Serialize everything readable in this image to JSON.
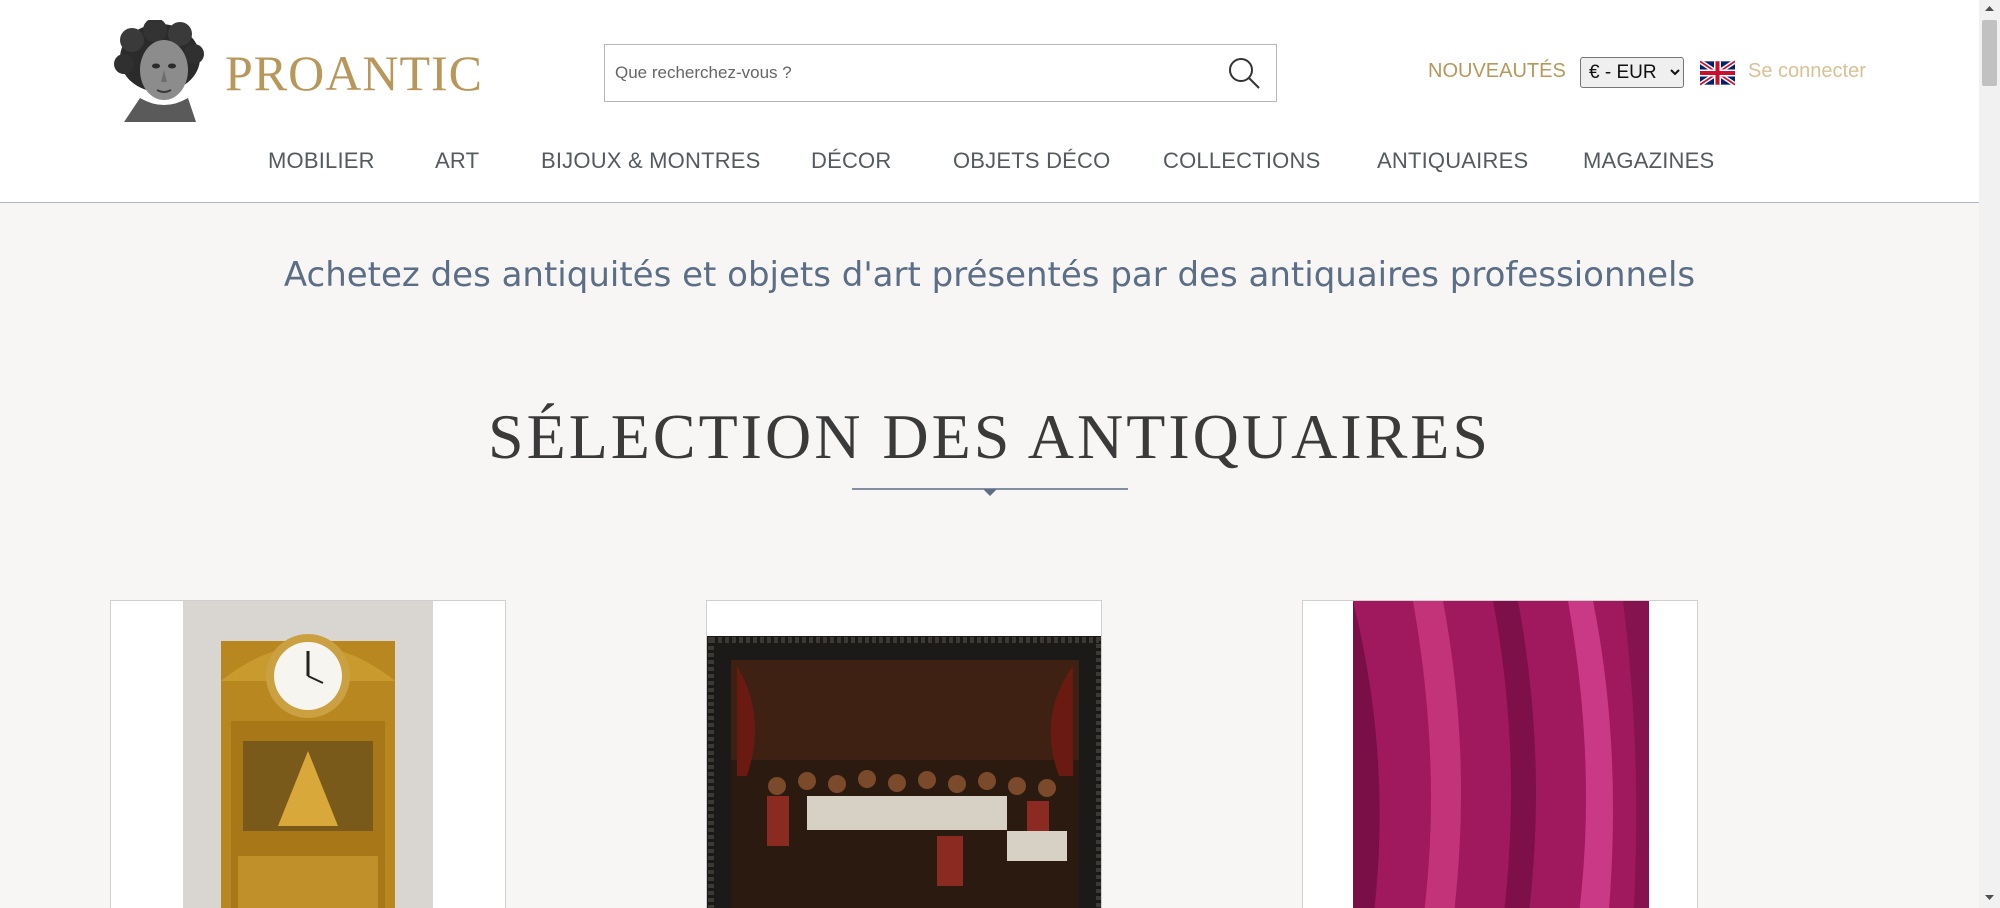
{
  "brand": {
    "name": "PROANTIC",
    "logo_icon": "bust-logo-icon"
  },
  "search": {
    "placeholder": "Que recherchez-vous ?"
  },
  "header": {
    "nouveautes": "NOUVEAUTÉS",
    "currency_selected": "€ - EUR",
    "language_icon": "uk-flag-icon",
    "login": "Se connecter"
  },
  "nav": {
    "items": [
      {
        "label": "MOBILIER"
      },
      {
        "label": "ART"
      },
      {
        "label": "BIJOUX & MONTRES"
      },
      {
        "label": "DÉCOR"
      },
      {
        "label": "OBJETS DÉCO"
      },
      {
        "label": "COLLECTIONS"
      },
      {
        "label": "ANTIQUAIRES"
      },
      {
        "label": "MAGAZINES"
      }
    ]
  },
  "hero": {
    "tagline": "Achetez des antiquités et objets d'art présentés par des antiquaires professionnels",
    "section_title": "SÉLECTION DES ANTIQUAIRES"
  },
  "colors": {
    "gold": "#b8975a",
    "gold_light": "#d8c197",
    "slate": "#5b6e85",
    "background": "#f7f6f4"
  }
}
